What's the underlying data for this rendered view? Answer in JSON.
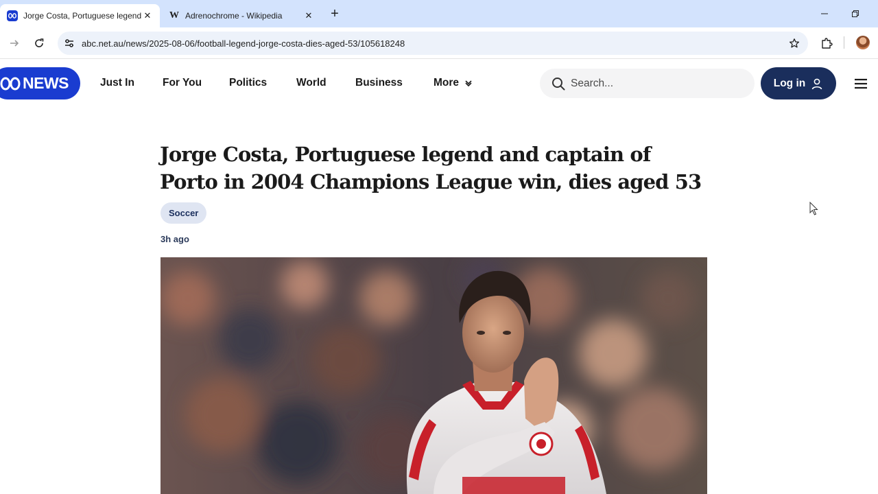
{
  "browser": {
    "tabs": [
      {
        "title": "Jorge Costa, Portuguese legend and captain of Porto",
        "favicon": "abc-icon",
        "active": true
      },
      {
        "title": "Adrenochrome - Wikipedia",
        "favicon": "wikipedia-icon",
        "active": false
      }
    ],
    "url": "abc.net.au/news/2025-08-06/football-legend-jorge-costa-dies-aged-53/105618248"
  },
  "site": {
    "logo_text": "NEWS",
    "nav": [
      "Just In",
      "For You",
      "Politics",
      "World",
      "Business",
      "More"
    ],
    "search_placeholder": "Search...",
    "login_label": "Log in",
    "brand_color": "#1a3cd0",
    "login_color": "#1a2e5c"
  },
  "article": {
    "headline": "Jorge Costa, Portuguese legend and captain of Porto in 2004 Champions League win, dies aged 53",
    "tag": "Soccer",
    "timestamp": "3h ago",
    "hero_image": "Footballer in white and red kit applauding"
  }
}
